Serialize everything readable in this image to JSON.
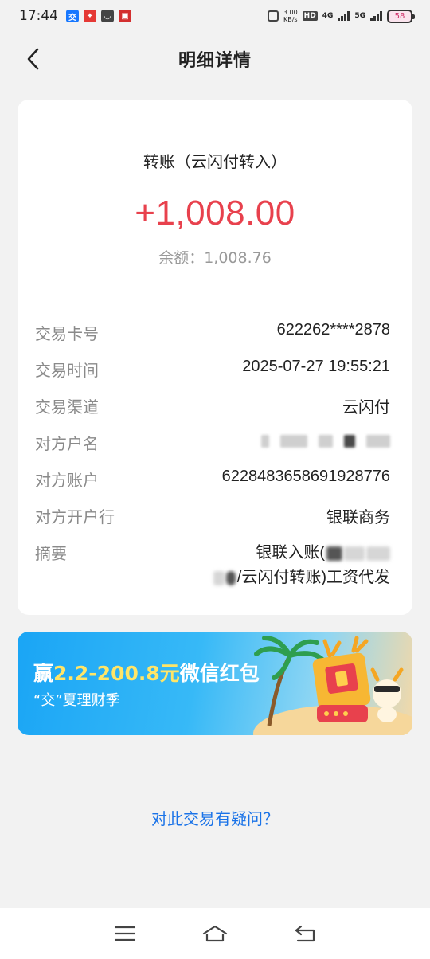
{
  "status_bar": {
    "time": "17:44",
    "speed_value": "3.00",
    "speed_unit": "KB/s",
    "hd": "HD",
    "net1": "4G",
    "net2": "5G",
    "battery": "58",
    "app_icons": [
      "jiao-app-icon",
      "red-app-icon",
      "dark-app-icon",
      "red-badge-icon"
    ]
  },
  "header": {
    "back_icon": "chevron-left-icon",
    "title": "明细详情"
  },
  "transaction": {
    "type": "转账（云闪付转入）",
    "amount": "+1,008.00",
    "balance_label": "余额：",
    "balance_value": "1,008.76",
    "rows": [
      {
        "label": "交易卡号",
        "value": "622262****2878"
      },
      {
        "label": "交易时间",
        "value": "2025-07-27 19:55:21"
      },
      {
        "label": "交易渠道",
        "value": "云闪付"
      },
      {
        "label": "对方户名",
        "value": ""
      },
      {
        "label": "对方账户",
        "value": "6228483658691928776"
      },
      {
        "label": "对方开户行",
        "value": "银联商务"
      }
    ],
    "memo_label": "摘要",
    "memo_line1": "银联入账(",
    "memo_line2": "/云闪付转账)工资代发"
  },
  "banner": {
    "title_prefix": "赢",
    "title_highlight": "2.2-200.8元",
    "title_suffix": "微信红包",
    "subtitle": "“交”夏理财季"
  },
  "question_link": "对此交易有疑问？",
  "nav": {
    "menu_icon": "menu-icon",
    "home_icon": "home-icon",
    "back_icon": "back-icon"
  },
  "colors": {
    "amount": "#e8414d",
    "link": "#1a73e8",
    "banner_highlight": "#ffe567"
  }
}
